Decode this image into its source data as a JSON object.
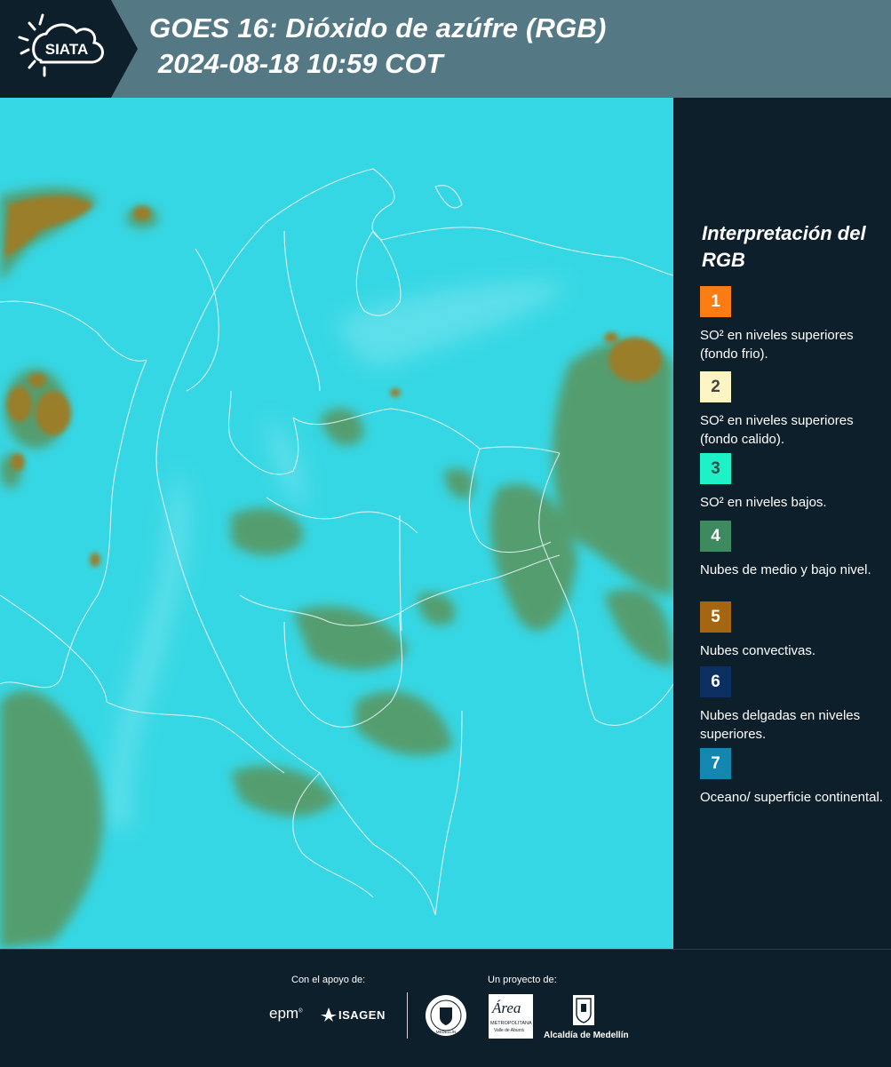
{
  "header": {
    "logo_text": "SIATA",
    "title": "GOES 16: Dióxido de azúfre (RGB)",
    "timestamp": "2024-08-18 10:59 COT"
  },
  "legend": {
    "title": "Interpretación del RGB",
    "items": [
      {
        "number": "1",
        "label": "SO² en niveles superiores (fondo frio).",
        "color": "#f97d13",
        "number_color": "#ffffff"
      },
      {
        "number": "2",
        "label": "SO² en niveles superiores (fondo calido).",
        "color": "#fdf6c4",
        "number_color": "#444444"
      },
      {
        "number": "3",
        "label": "SO² en niveles bajos.",
        "color": "#1ef0c8",
        "number_color": "#2f4f4f"
      },
      {
        "number": "4",
        "label": "Nubes de medio y bajo nivel.",
        "color": "#3d8a5f",
        "number_color": "#ffffff"
      },
      {
        "number": "5",
        "label": "Nubes convectivas.",
        "color": "#a46610",
        "number_color": "#ffffff"
      },
      {
        "number": "6",
        "label": "Nubes delgadas en niveles superiores.",
        "color": "#0c2f61",
        "number_color": "#ffffff"
      },
      {
        "number": "7",
        "label": "Oceano/ superficie continental.",
        "color": "#1387b0",
        "number_color": "#ffffff"
      }
    ]
  },
  "map": {
    "background_color": "#36d7e4",
    "cloud_color": "#6e7f3a",
    "convective_color": "#9a7e2c",
    "border_color": "#e6f4f7"
  },
  "footer": {
    "support_label": "Con el apoyo de:",
    "project_label": "Un proyecto de:",
    "epm": "epm",
    "isagen": "ISAGEN",
    "seal_text": "MEDELLÍN",
    "area_text": "Área",
    "area_sub1": "METROPOLITANA",
    "area_sub2": "Valle de Aburrá",
    "alcaldia": "Alcaldía de Medellín"
  }
}
